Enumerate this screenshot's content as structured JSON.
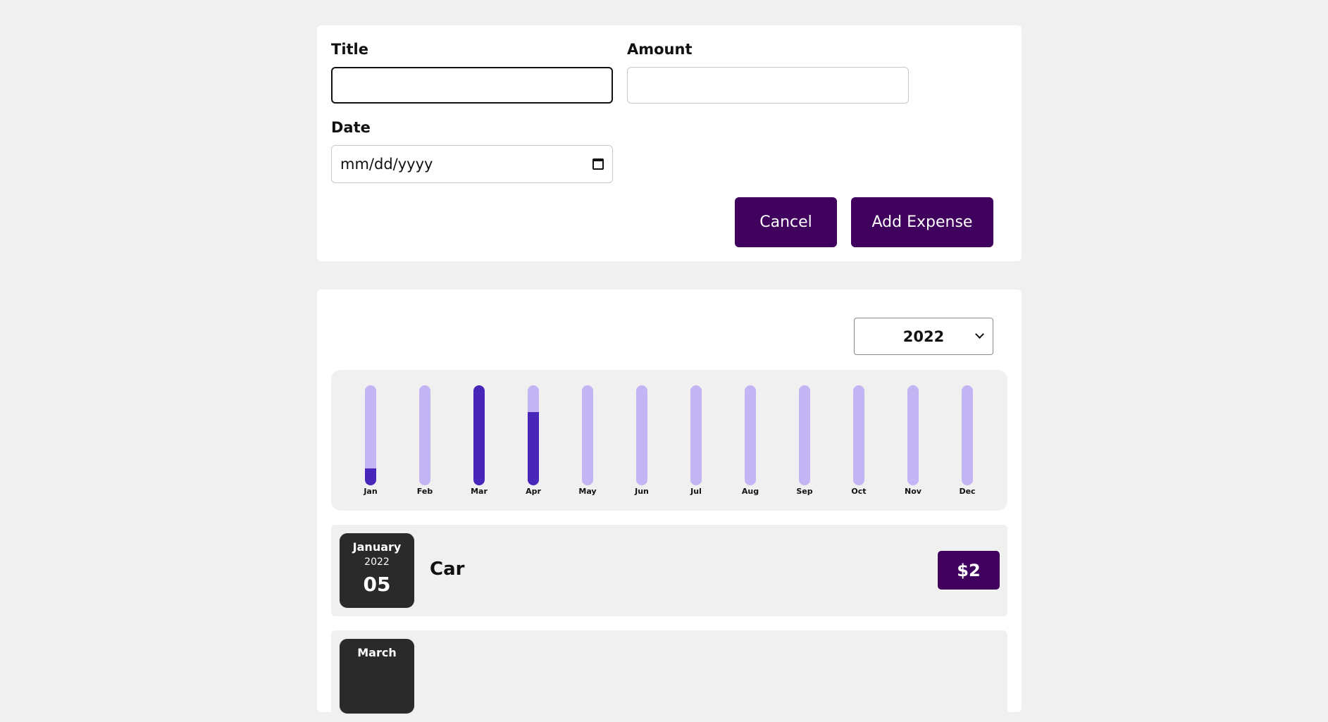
{
  "form": {
    "title_label": "Title",
    "title_value": "",
    "amount_label": "Amount",
    "amount_value": "",
    "date_label": "Date",
    "date_placeholder": "mm/dd/yyyy",
    "cancel_label": "Cancel",
    "add_label": "Add Expense"
  },
  "filter": {
    "selected_year": "2022"
  },
  "chart_data": {
    "type": "bar",
    "categories": [
      "Jan",
      "Feb",
      "Mar",
      "Apr",
      "May",
      "Jun",
      "Jul",
      "Aug",
      "Sep",
      "Oct",
      "Nov",
      "Dec"
    ],
    "values": [
      0.17,
      0,
      1,
      0.73,
      0,
      0,
      0,
      0,
      0,
      0,
      0,
      0
    ],
    "ylim": [
      0,
      1
    ]
  },
  "expenses": [
    {
      "month": "January",
      "year": "2022",
      "day": "05",
      "title": "Car",
      "amount": "$2"
    },
    {
      "month": "March",
      "year": "",
      "day": "",
      "title": "",
      "amount": ""
    }
  ],
  "colors": {
    "accent": "#40005d",
    "bar_track": "#c3b4f3",
    "bar_fill": "#4826b9"
  }
}
